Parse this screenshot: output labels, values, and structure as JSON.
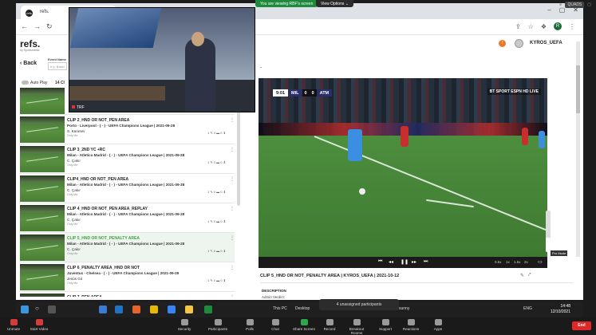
{
  "zoom": {
    "share_banner": "You are viewing RBF's screen",
    "view_options": "View Options",
    "top_pill": "QUADS",
    "bottom_bar": [
      {
        "name": "unmute",
        "label": "Unmute"
      },
      {
        "name": "start-video",
        "label": "Start Video"
      },
      {
        "name": "security",
        "label": "Security"
      },
      {
        "name": "participants",
        "label": "Participants"
      },
      {
        "name": "polls",
        "label": "Polls"
      },
      {
        "name": "chat",
        "label": "Chat"
      },
      {
        "name": "share-screen",
        "label": "Share Screen"
      },
      {
        "name": "record",
        "label": "Record"
      },
      {
        "name": "breakout-rooms",
        "label": "Breakout Rooms"
      },
      {
        "name": "support",
        "label": "Support"
      },
      {
        "name": "reactions",
        "label": "Reactions"
      },
      {
        "name": "apps",
        "label": "Apps"
      }
    ],
    "end_label": "End",
    "unassigned": "4 unassigned participants"
  },
  "browser": {
    "tab_title": "refs.",
    "tab_favicon": "refs",
    "profile_initial": "R"
  },
  "app": {
    "logo": "refs.",
    "logo_sub": "by Sportsmedia",
    "user_name": "KYROS_UEFA",
    "notif": "!",
    "back_label": "Back",
    "event_label": "Event Name",
    "event_placeholder": "e.g. Basel",
    "autoplay_label": "Auto Play",
    "clip_count": "14 Cl"
  },
  "camera": {
    "name": "TRF"
  },
  "clips": [
    {
      "title": "",
      "match": "",
      "referee": "",
      "vis": "",
      "stats": "",
      "selected": false,
      "partial": true
    },
    {
      "title": "CLIP 2_HND OR NOT_PEN AREA",
      "match": "Porto - Liverpool - ( - ) - UEFA Champions League | 2021-09-28",
      "referee": "S. Karasev",
      "vis": "Only Me",
      "stats": "1 ✎  0 ▬  0 ⬇",
      "selected": false
    },
    {
      "title": "CLIP 3_2ND YC +RC",
      "match": "Milan - Atletico Madrid - ( - ) - UEFA Champions League | 2021-09-28",
      "referee": "C. Çakır",
      "vis": "Only Me",
      "stats": "1 ✎  0 ▬  0 ⬇",
      "selected": false
    },
    {
      "title": "CLIP4_HND OR NOT_PEN AREA",
      "match": "Milan - Atletico Madrid - ( - ) - UEFA Champions League | 2021-09-28",
      "referee": "C. Çakır",
      "vis": "Only Me",
      "stats": "1 ✎  0 ▬  0 ⬇",
      "selected": false
    },
    {
      "title": "CLIP 4_HND OR NOT_PEN AREA_REPLAY",
      "match": "Milan - Atletico Madrid - ( - ) - UEFA Champions League | 2021-09-28",
      "referee": "C. Çakır",
      "vis": "Only Me",
      "stats": "1 ✎  0 ▬  0 ⬇",
      "selected": false
    },
    {
      "title": "CLIP 5_HND OR NOT_PENALTY AREA",
      "match": "Milan - Atletico Madrid - ( - ) - UEFA Champions League | 2021-09-28",
      "referee": "C. Çakır",
      "vis": "Only Me",
      "stats": "1 ✎  0 ▬  0 ⬇",
      "selected": true
    },
    {
      "title": "CLIP 6_PENALTY AREA_HND OR NOT",
      "match": "Juventus - Chelsea - ( - ) - UEFA Champions League | 2021-09-29",
      "referee": "Jesús Gil",
      "vis": "Only Me",
      "stats": "1 ✎  0 ▬  0 ⬇",
      "selected": false
    },
    {
      "title": "CLIP 7_PEN AREA",
      "match": "",
      "referee": "",
      "vis": "",
      "stats": "",
      "selected": false
    }
  ],
  "video": {
    "clock": "9:01",
    "home": "MIL",
    "home_score": "0",
    "away_score": "0",
    "away": "ATM",
    "channel": "BT SPORT ESPN HD LIVE",
    "speeds": [
      "0.5x",
      "1x",
      "1.5x",
      "2x"
    ],
    "mode_tip": "Pro Mode",
    "clip_title": "CLIP 5_HND OR NOT_PENALTY AREA | KYROS_UEFA | 2021-10-12",
    "description_label": "DESCRIPTION",
    "verdict_label": "Admin Verdict:"
  },
  "taskbar": {
    "this_pc": "This PC",
    "desktop": "Desktop",
    "weather": "sunny",
    "lang": "ENG",
    "time": "14:48",
    "date": "12/10/2021"
  },
  "colors": {
    "accent_green": "#43a047",
    "share_green": "#1e8a3b",
    "end_red": "#e02828"
  }
}
